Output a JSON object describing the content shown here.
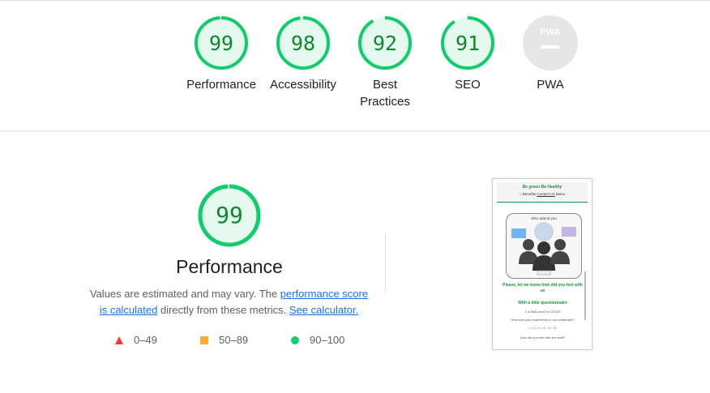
{
  "categories": [
    {
      "label": "Performance",
      "score": "99",
      "value": 0.99
    },
    {
      "label": "Accessibility",
      "score": "98",
      "value": 0.98
    },
    {
      "label": "Best Practices",
      "score": "92",
      "value": 0.92
    },
    {
      "label": "SEO",
      "score": "91",
      "value": 0.91
    },
    {
      "label": "PWA",
      "score": "",
      "value": 0
    }
  ],
  "pwa_badge_text": "PWA",
  "performance": {
    "score": "99",
    "title": "Performance",
    "desc_part1": "Values are estimated and may vary. The ",
    "link1": "performance score is calculated",
    "desc_part2": " directly from these metrics. ",
    "link2": "See calculator."
  },
  "legend": [
    {
      "range": "0–49",
      "color": "#ff3333",
      "shape": "triangle"
    },
    {
      "range": "50–89",
      "color": "#ffaa33",
      "shape": "square"
    },
    {
      "range": "90–100",
      "color": "#0cce6b",
      "shape": "circle"
    }
  ],
  "colors": {
    "pass": "#0cce6b",
    "pass_bg": "#e6f9ef",
    "pass_text": "#0b8a2e",
    "pwa_bg": "#e6e6e6",
    "pwa_fg": "#ffffff"
  },
  "screenshot": {
    "brand": "Be green Be Healthy",
    "nav_home": "⌂",
    "nav_benefits": "Benefits",
    "nav_contact": "Contact Us",
    "nav_menu": "Menu",
    "who": "Who attend you",
    "text1": "Please, let we know how did you feel with us",
    "text2": "With a little questionnaire",
    "q_scale": "1 is BAD and 5 is GOOD",
    "q1": "How was your experience in our restaurant?",
    "q_opts": "○ 1 ○ 2 ○ 3 ○ 4 ○ 5",
    "q2": "How did you feel with the staff?"
  }
}
